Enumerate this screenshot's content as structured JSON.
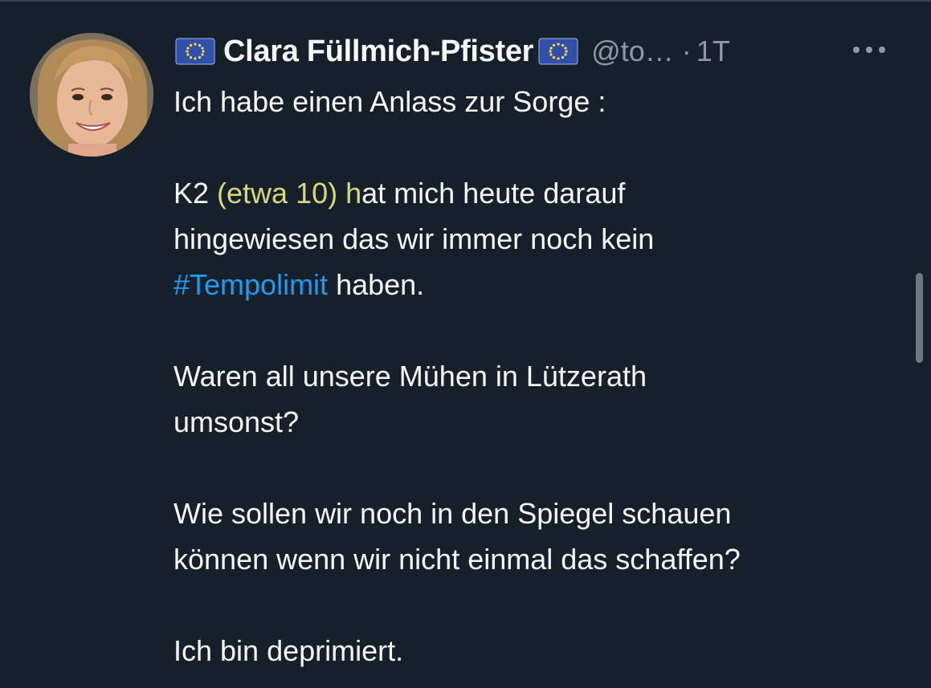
{
  "tweet": {
    "author": {
      "display_name": "Clara Füllmich-Pfister",
      "handle": "@to…",
      "separator": "·",
      "time": "1T",
      "avatar_icon": "avatar-photo",
      "flag_icon": "eu-flag-icon"
    },
    "more_icon": "more-options-icon",
    "text": {
      "line1": "Ich habe einen Anlass zur Sorge :",
      "p2_prefix": "K2 ",
      "p2_highlight": "(etwa 10) h",
      "p2_rest_line": "at mich heute darauf",
      "p2_line2": "hingewiesen das wir immer noch kein",
      "hashtag": "#Tempolimit",
      "p2_end": " haben.",
      "p3_line1": "Waren all unsere Mühen in Lützerath",
      "p3_line2": "umsonst?",
      "p4_line1": "Wie sollen wir noch in den Spiegel schauen",
      "p4_line2": "können wenn wir nicht einmal das schaffen?",
      "p5": "Ich bin deprimiert."
    }
  },
  "colors": {
    "background": "#15202b",
    "text": "#f7f9f9",
    "secondary_text": "#8b98a5",
    "link": "#1d9bf0",
    "highlight": "#e0e046"
  }
}
